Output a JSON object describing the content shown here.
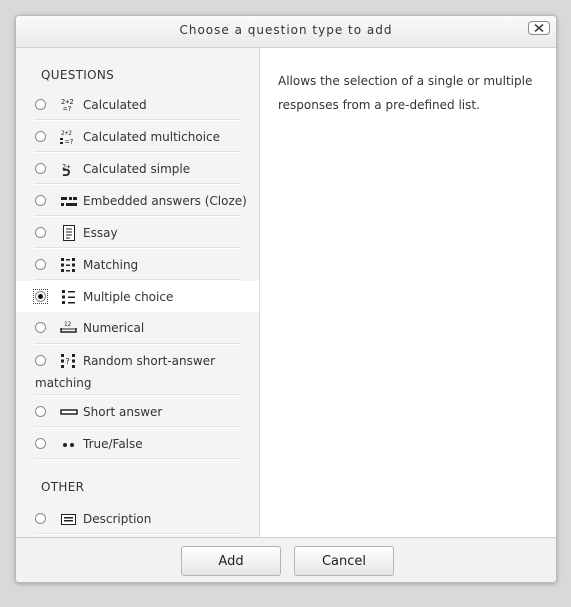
{
  "dialog": {
    "title": "Choose a question type to add",
    "close_icon": "close-x-icon"
  },
  "sections": {
    "questions_label": "QUESTIONS",
    "other_label": "OTHER"
  },
  "options": [
    {
      "label": "Calculated",
      "icon": "calculated-icon",
      "selected": false
    },
    {
      "label": "Calculated multichoice",
      "icon": "calculated-multichoice-icon",
      "selected": false
    },
    {
      "label": "Calculated simple",
      "icon": "calculated-simple-icon",
      "selected": false
    },
    {
      "label": "Embedded answers (Cloze)",
      "icon": "cloze-icon",
      "selected": false
    },
    {
      "label": "Essay",
      "icon": "essay-icon",
      "selected": false
    },
    {
      "label": "Matching",
      "icon": "matching-icon",
      "selected": false
    },
    {
      "label": "Multiple choice",
      "icon": "multiple-choice-icon",
      "selected": true
    },
    {
      "label": "Numerical",
      "icon": "numerical-icon",
      "selected": false
    },
    {
      "label": "Random short-answer",
      "label_line2": "matching",
      "icon": "random-short-answer-icon",
      "selected": false
    },
    {
      "label": "Short answer",
      "icon": "short-answer-icon",
      "selected": false
    },
    {
      "label": "True/False",
      "icon": "true-false-icon",
      "selected": false
    }
  ],
  "other_options": [
    {
      "label": "Description",
      "icon": "description-icon",
      "selected": false
    }
  ],
  "description": {
    "line1": "Allows the selection of a single or multiple",
    "line2": "responses from a pre-defined list."
  },
  "footer": {
    "add_label": "Add",
    "cancel_label": "Cancel"
  }
}
